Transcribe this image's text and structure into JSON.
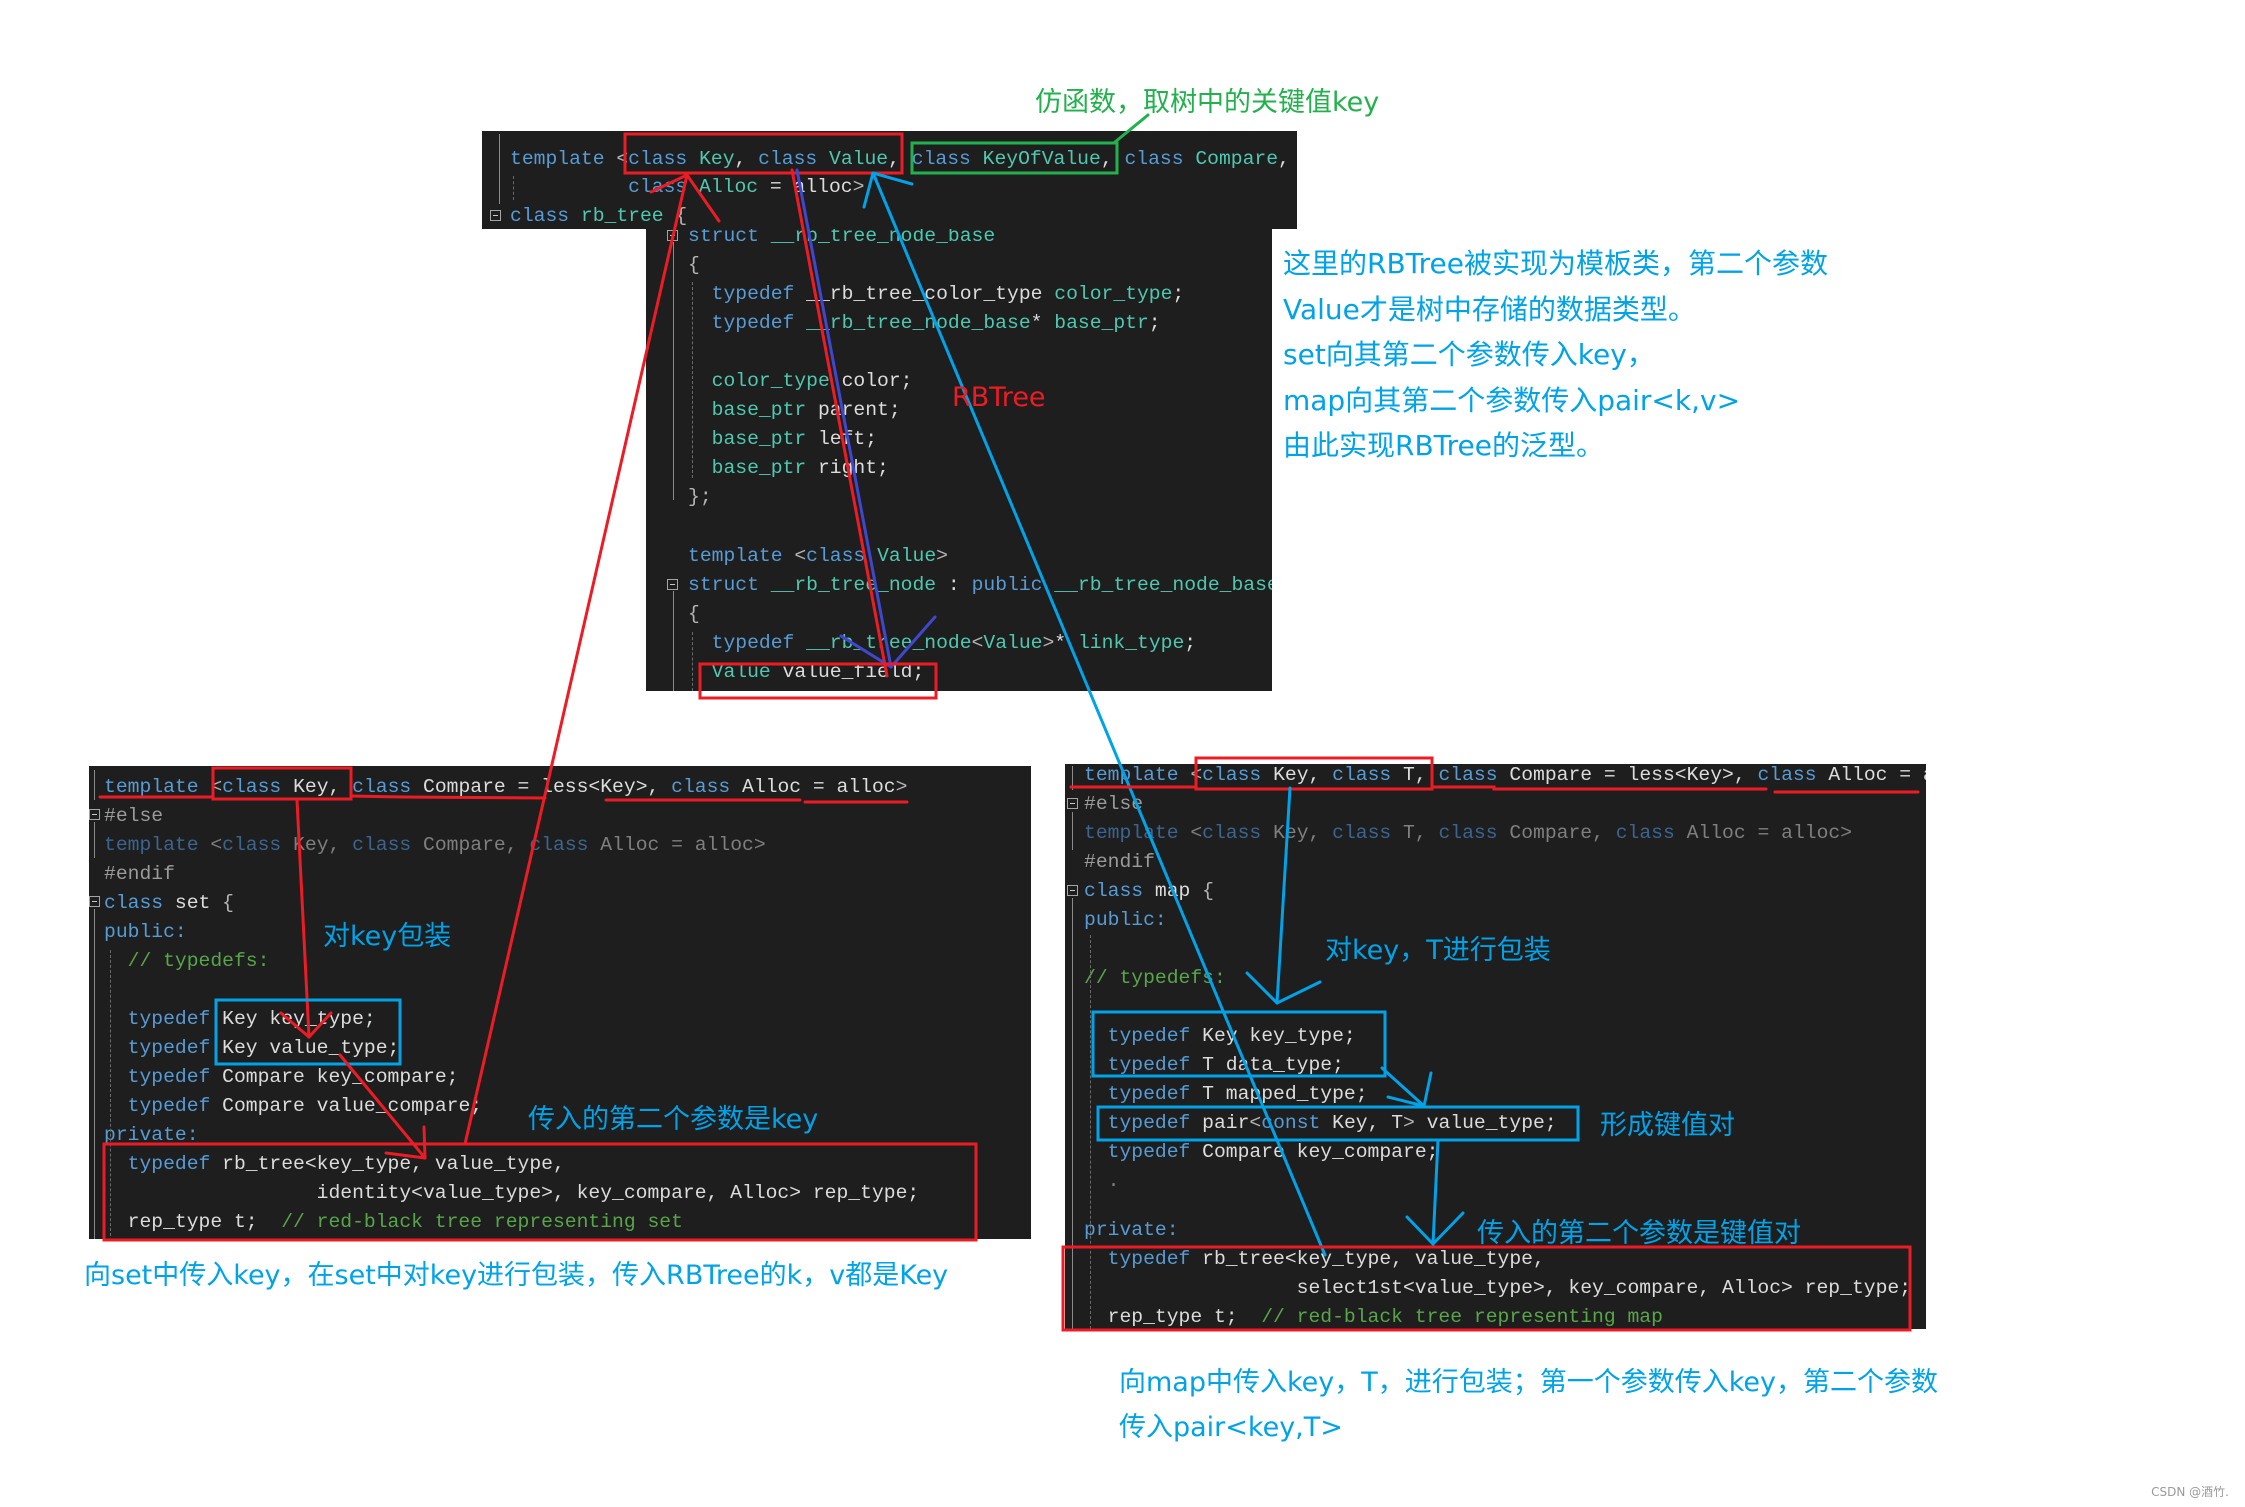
{
  "colors": {
    "editor_bg": "#1E1E1E",
    "keyword": "#569CD6",
    "type": "#4EC9B0",
    "text": "#DCDCDC",
    "punct": "#B4B4B4",
    "comment": "#57A64A",
    "preprocessor": "#9B9B9B",
    "inactive_keyword": "#3B6591",
    "inactive_text": "#7F7F7F",
    "annotation_blue": "#00A2E8",
    "annotation_red": "#ED1C24",
    "annotation_green": "#22B14C",
    "annotation_purple": "#3F48CC"
  },
  "code": {
    "rb_tree_header": {
      "lines": [
        [
          {
            "t": "template ",
            "k": "kw"
          },
          {
            "t": "<",
            "k": "pu"
          },
          {
            "t": "class ",
            "k": "kw"
          },
          {
            "t": "Key",
            "k": "ty"
          },
          {
            "t": ", ",
            "k": "tx"
          },
          {
            "t": "class ",
            "k": "kw"
          },
          {
            "t": "Value",
            "k": "ty"
          },
          {
            "t": ", ",
            "k": "tx"
          },
          {
            "t": "class ",
            "k": "kw"
          },
          {
            "t": "KeyOfValue",
            "k": "ty"
          },
          {
            "t": ", ",
            "k": "tx"
          },
          {
            "t": "class ",
            "k": "kw"
          },
          {
            "t": "Compare",
            "k": "ty"
          },
          {
            "t": ",",
            "k": "tx"
          }
        ],
        [
          {
            "t": "          class ",
            "k": "kw"
          },
          {
            "t": "Alloc",
            "k": "ty"
          },
          {
            "t": " = alloc",
            "k": "tx"
          },
          {
            "t": ">",
            "k": "pu"
          }
        ],
        [
          {
            "t": "class ",
            "k": "kw"
          },
          {
            "t": "rb_tree",
            "k": "ty"
          },
          {
            "t": " {",
            "k": "pu"
          }
        ]
      ]
    },
    "rb_tree_nodes": {
      "lines": [
        [
          {
            "t": "struct ",
            "k": "kw"
          },
          {
            "t": "__rb_tree_node_base",
            "k": "ty"
          }
        ],
        [
          {
            "t": "{",
            "k": "pu"
          }
        ],
        [
          {
            "t": "  typedef ",
            "k": "kw"
          },
          {
            "t": "__rb_tree_color_type ",
            "k": "tx"
          },
          {
            "t": "color_type",
            "k": "ty"
          },
          {
            "t": ";",
            "k": "tx"
          }
        ],
        [
          {
            "t": "  typedef ",
            "k": "kw"
          },
          {
            "t": "__rb_tree_node_base",
            "k": "ty"
          },
          {
            "t": "* ",
            "k": "tx"
          },
          {
            "t": "base_ptr",
            "k": "ty"
          },
          {
            "t": ";",
            "k": "tx"
          }
        ],
        [],
        [
          {
            "t": "  color_type",
            "k": "ty"
          },
          {
            "t": " color;",
            "k": "tx"
          }
        ],
        [
          {
            "t": "  base_ptr",
            "k": "ty"
          },
          {
            "t": " parent;",
            "k": "tx"
          }
        ],
        [
          {
            "t": "  base_ptr",
            "k": "ty"
          },
          {
            "t": " left;",
            "k": "tx"
          }
        ],
        [
          {
            "t": "  base_ptr",
            "k": "ty"
          },
          {
            "t": " right;",
            "k": "tx"
          }
        ],
        [
          {
            "t": "};",
            "k": "pu"
          }
        ],
        [],
        [
          {
            "t": "template ",
            "k": "kw"
          },
          {
            "t": "<",
            "k": "pu"
          },
          {
            "t": "class ",
            "k": "kw"
          },
          {
            "t": "Value",
            "k": "ty"
          },
          {
            "t": ">",
            "k": "pu"
          }
        ],
        [
          {
            "t": "struct ",
            "k": "kw"
          },
          {
            "t": "__rb_tree_node",
            "k": "ty"
          },
          {
            "t": " : ",
            "k": "tx"
          },
          {
            "t": "public ",
            "k": "kw"
          },
          {
            "t": "__rb_tree_node_base",
            "k": "ty"
          }
        ],
        [
          {
            "t": "{",
            "k": "pu"
          }
        ],
        [
          {
            "t": "  typedef ",
            "k": "kw"
          },
          {
            "t": "__rb_tree_node",
            "k": "ty"
          },
          {
            "t": "<",
            "k": "pu"
          },
          {
            "t": "Value",
            "k": "ty"
          },
          {
            "t": ">",
            "k": "pu"
          },
          {
            "t": "* ",
            "k": "tx"
          },
          {
            "t": "link_type",
            "k": "ty"
          },
          {
            "t": ";",
            "k": "tx"
          }
        ],
        [
          {
            "t": "  Value",
            "k": "ty"
          },
          {
            "t": " value_field;",
            "k": "tx"
          }
        ]
      ]
    },
    "set_class": {
      "lines": [
        [
          {
            "t": "template ",
            "k": "kw"
          },
          {
            "t": "<",
            "k": "pu"
          },
          {
            "t": "class ",
            "k": "kw"
          },
          {
            "t": "Key, ",
            "k": "tx"
          },
          {
            "t": "class ",
            "k": "kw"
          },
          {
            "t": "Compare = less<Key>, ",
            "k": "tx"
          },
          {
            "t": "class ",
            "k": "kw"
          },
          {
            "t": "Alloc = alloc",
            "k": "tx"
          },
          {
            "t": ">",
            "k": "pu"
          }
        ],
        [
          {
            "t": "#else",
            "k": "pp"
          }
        ],
        [
          {
            "t": "template ",
            "k": "dk"
          },
          {
            "t": "<",
            "k": "dt"
          },
          {
            "t": "class ",
            "k": "dk"
          },
          {
            "t": "Key, ",
            "k": "dt"
          },
          {
            "t": "class ",
            "k": "dk"
          },
          {
            "t": "Compare, ",
            "k": "dt"
          },
          {
            "t": "class ",
            "k": "dk"
          },
          {
            "t": "Alloc = alloc>",
            "k": "dt"
          }
        ],
        [
          {
            "t": "#endif",
            "k": "pp"
          }
        ],
        [
          {
            "t": "class ",
            "k": "kw"
          },
          {
            "t": "set",
            "k": "tx"
          },
          {
            "t": " {",
            "k": "pu"
          }
        ],
        [
          {
            "t": "public:",
            "k": "kw"
          }
        ],
        [
          {
            "t": "  // typedefs:",
            "k": "cm"
          }
        ],
        [],
        [
          {
            "t": "  typedef ",
            "k": "kw"
          },
          {
            "t": "Key key_type;",
            "k": "tx"
          }
        ],
        [
          {
            "t": "  typedef ",
            "k": "kw"
          },
          {
            "t": "Key value_type;",
            "k": "tx"
          }
        ],
        [
          {
            "t": "  typedef ",
            "k": "kw"
          },
          {
            "t": "Compare key_compare;",
            "k": "tx"
          }
        ],
        [
          {
            "t": "  typedef ",
            "k": "kw"
          },
          {
            "t": "Compare value_compare;",
            "k": "tx"
          }
        ],
        [
          {
            "t": "private:",
            "k": "kw"
          }
        ],
        [
          {
            "t": "  typedef ",
            "k": "kw"
          },
          {
            "t": "rb_tree<key_type, value_type,",
            "k": "tx"
          }
        ],
        [
          {
            "t": "                  identity<value_type>, key_compare, Alloc> rep_type;",
            "k": "tx"
          }
        ],
        [
          {
            "t": "  rep_type t;  ",
            "k": "tx"
          },
          {
            "t": "// red-black tree representing set",
            "k": "cm"
          }
        ]
      ]
    },
    "map_class": {
      "lines_top": [
        [
          {
            "t": "template ",
            "k": "kw"
          },
          {
            "t": "<",
            "k": "pu"
          },
          {
            "t": "class ",
            "k": "kw"
          },
          {
            "t": "Key, ",
            "k": "tx"
          },
          {
            "t": "class ",
            "k": "kw"
          },
          {
            "t": "T, ",
            "k": "tx"
          },
          {
            "t": "class ",
            "k": "kw"
          },
          {
            "t": "Compare = less<Key>, ",
            "k": "tx"
          },
          {
            "t": "class ",
            "k": "kw"
          },
          {
            "t": "Alloc = alloc",
            "k": "tx"
          },
          {
            "t": ">",
            "k": "pu"
          }
        ],
        [
          {
            "t": "#else",
            "k": "pp"
          }
        ],
        [
          {
            "t": "template ",
            "k": "dk"
          },
          {
            "t": "<",
            "k": "dt"
          },
          {
            "t": "class ",
            "k": "dk"
          },
          {
            "t": "Key, ",
            "k": "dt"
          },
          {
            "t": "class ",
            "k": "dk"
          },
          {
            "t": "T, ",
            "k": "dt"
          },
          {
            "t": "class ",
            "k": "dk"
          },
          {
            "t": "Compare, ",
            "k": "dt"
          },
          {
            "t": "class ",
            "k": "dk"
          },
          {
            "t": "Alloc = alloc>",
            "k": "dt"
          }
        ],
        [
          {
            "t": "#endif",
            "k": "pp"
          }
        ],
        [
          {
            "t": "class ",
            "k": "kw"
          },
          {
            "t": "map",
            "k": "tx"
          },
          {
            "t": " {",
            "k": "pu"
          }
        ],
        [
          {
            "t": "public:",
            "k": "kw"
          }
        ],
        [],
        [
          {
            "t": "// typedefs:",
            "k": "cm"
          }
        ],
        [],
        [
          {
            "t": "  typedef ",
            "k": "kw"
          },
          {
            "t": "Key key_type;",
            "k": "tx"
          }
        ],
        [
          {
            "t": "  typedef ",
            "k": "kw"
          },
          {
            "t": "T data_type;",
            "k": "tx"
          }
        ],
        [
          {
            "t": "  typedef ",
            "k": "kw"
          },
          {
            "t": "T mapped_type;",
            "k": "tx"
          }
        ],
        [
          {
            "t": "  typedef ",
            "k": "kw"
          },
          {
            "t": "pair",
            "k": "tx"
          },
          {
            "t": "<",
            "k": "pu"
          },
          {
            "t": "const ",
            "k": "kw"
          },
          {
            "t": "Key, T",
            "k": "tx"
          },
          {
            "t": ">",
            "k": "pu"
          },
          {
            "t": " value_type;",
            "k": "tx"
          }
        ],
        [
          {
            "t": "  typedef ",
            "k": "kw"
          },
          {
            "t": "Compare key_compare;",
            "k": "tx"
          }
        ],
        [
          {
            "t": "  .",
            "k": "dt"
          }
        ]
      ],
      "lines_private": [
        [
          {
            "t": "private:",
            "k": "kw"
          }
        ],
        [
          {
            "t": "  typedef ",
            "k": "kw"
          },
          {
            "t": "rb_tree<key_type, value_type,",
            "k": "tx"
          }
        ],
        [
          {
            "t": "                  select1st<value_type>, key_compare, Alloc> rep_type;",
            "k": "tx"
          }
        ],
        [
          {
            "t": "  rep_type t;  ",
            "k": "tx"
          },
          {
            "t": "// red-black tree representing map",
            "k": "cm"
          }
        ]
      ]
    }
  },
  "annotations": {
    "functor_note": "仿函数，取树中的关键值key",
    "rbtree_label": "RBTree",
    "generic_note": [
      "这里的RBTree被实现为模板类，第二个参数",
      "Value才是树中存储的数据类型。",
      "set向其第二个参数传入key，",
      "map向其第二个参数传入pair<k,v>",
      "由此实现RBTree的泛型。"
    ],
    "set_wrap_key": "对key包装",
    "set_second_param": "传入的第二个参数是key",
    "set_caption": "向set中传入key，在set中对key进行包装，传入RBTree的k，v都是Key",
    "map_wrap": "对key，T进行包装",
    "map_pair": "形成键值对",
    "map_second_param": "传入的第二个参数是键值对",
    "map_caption": [
      "向map中传入key，T，进行包装；第一个参数传入key，第二个参数",
      "传入pair<key,T>"
    ]
  },
  "watermark": "CSDN @酒竹."
}
